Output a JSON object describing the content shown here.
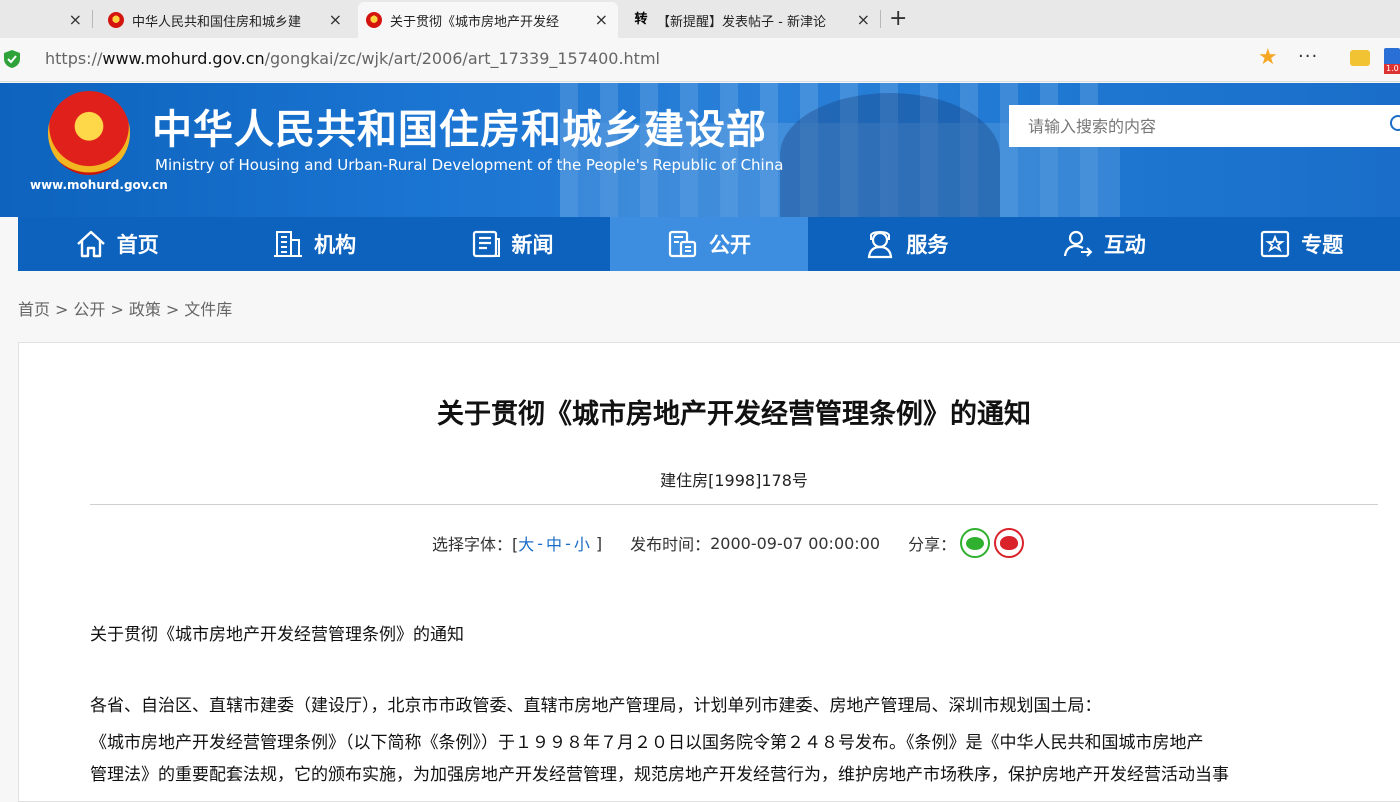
{
  "browser": {
    "tabs": [
      {
        "title": "",
        "active": false
      },
      {
        "title": "中华人民共和国住房和城乡建",
        "active": false
      },
      {
        "title": "关于贯彻《城市房地产开发经",
        "active": true
      },
      {
        "title": "【新提醒】发表帖子 - 新津论",
        "active": false
      }
    ],
    "tab_close_glyph": "×",
    "new_tab_glyph": "+",
    "favicon_te": "转",
    "url_scheme": "https://",
    "url_host": "www.mohurd.gov.cn",
    "url_path": "/gongkai/zc/wjk/art/2006/art_17339_157400.html",
    "more_glyph": "···",
    "star_glyph": "★",
    "ext_badge": "1.0"
  },
  "header": {
    "site_title": "中华人民共和国住房和城乡建设部",
    "site_subtitle": "Ministry of Housing and Urban-Rural Development of the People's Republic of China",
    "site_url_label": "www.mohurd.gov.cn",
    "search_placeholder": "请输入搜索的内容",
    "emblem_star": "★"
  },
  "nav": {
    "items": [
      {
        "label": "首页",
        "icon": "home-icon",
        "active": false
      },
      {
        "label": "机构",
        "icon": "building-icon",
        "active": false
      },
      {
        "label": "新闻",
        "icon": "news-icon",
        "active": false
      },
      {
        "label": "公开",
        "icon": "public-docs-icon",
        "active": true
      },
      {
        "label": "服务",
        "icon": "service-icon",
        "active": false
      },
      {
        "label": "互动",
        "icon": "interact-icon",
        "active": false
      },
      {
        "label": "专题",
        "icon": "topic-icon",
        "active": false
      }
    ]
  },
  "breadcrumb": {
    "items": [
      "首页",
      "公开",
      "政策",
      "文件库"
    ],
    "separator": ">"
  },
  "article": {
    "title": "关于贯彻《城市房地产开发经营管理条例》的通知",
    "doc_number": "建住房[1998]178号",
    "font_size_label": "选择字体：[",
    "font_size_close": "]",
    "font_large": "大",
    "font_medium": "中",
    "font_small": "小",
    "font_dash": "-",
    "publish_label": "发布时间：",
    "publish_time": "2000-09-07 00:00:00",
    "share_label": "分享：",
    "paragraphs": [
      "关于贯彻《城市房地产开发经营管理条例》的通知",
      "各省、自治区、直辖市建委（建设厅），北京市市政管委、直辖市房地产管理局，计划单列市建委、房地产管理局、深圳市规划国土局：",
      "《城市房地产开发经营管理条例》（以下简称《条例》）于１９９８年７月２０日以国务院令第２４８号发布。《条例》是《中华人民共和国城市房地产",
      "管理法》的重要配套法规，它的颁布实施，为加强房地产开发经营管理，规范房地产开发经营行为，维护房地产市场秩序，保护房地产开发经营活动当事"
    ]
  },
  "colors": {
    "nav_bg": "#0c62bd",
    "nav_active": "#3d8ee0",
    "link_blue": "#1a6ec9",
    "wechat_green": "#2fb12f",
    "weibo_red": "#d9222a"
  }
}
